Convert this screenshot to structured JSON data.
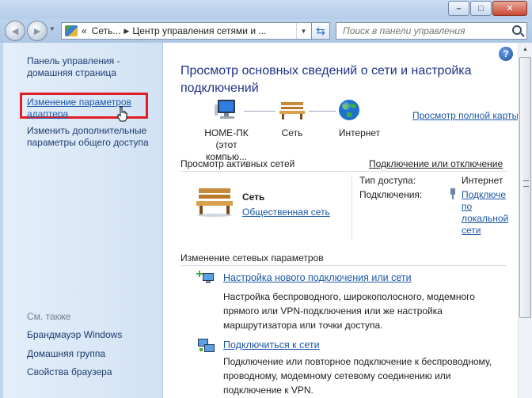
{
  "window": {
    "minimize_glyph": "–",
    "maximize_glyph": "□",
    "close_glyph": "✕"
  },
  "toolbar": {
    "back_glyph": "◄",
    "forward_glyph": "►",
    "address_chevron": "«",
    "breadcrumb_1": "Сеть...",
    "breadcrumb_2": "Центр управления сетями и ...",
    "breadcrumb_sep": "▶",
    "search_placeholder": "Поиск в панели управления"
  },
  "sidebar": {
    "home": "Панель управления - домашняя страница",
    "adapter": "Изменение параметров адаптера",
    "sharing": "Изменить дополнительные параметры общего доступа",
    "see_also": "См. также",
    "links": [
      "Брандмауэр Windows",
      "Домашняя группа",
      "Свойства браузера"
    ]
  },
  "main": {
    "help": "?",
    "title": "Просмотр основных сведений о сети и настройка подключений",
    "full_map": "Просмотр полной карты",
    "map": {
      "computer": "HOME-ПК",
      "computer_sub": "(этот компью...",
      "network": "Сеть",
      "internet": "Интернет"
    },
    "active_networks": "Просмотр активных сетей",
    "connect_disconnect": "Подключение или отключение",
    "network": {
      "name": "Сеть",
      "category": "Общественная сеть",
      "access_type_label": "Тип доступа:",
      "access_type_value": "Интернет",
      "connections_label": "Подключения:",
      "connections_value": [
        "Подключе",
        "по",
        "локальной",
        "сети"
      ]
    },
    "change_settings": "Изменение сетевых параметров",
    "tasks": [
      {
        "title": "Настройка нового подключения или сети",
        "desc": [
          "Настройка беспроводного, широкополосного, модемного",
          "прямого или VPN-подключения или же настройка",
          "маршрутизатора или точки доступа."
        ]
      },
      {
        "title": "Подключиться к сети",
        "desc": [
          "Подключение или повторное подключение к беспроводному,",
          "проводному, модемному сетевому соединению или",
          "подключение к VPN."
        ]
      }
    ]
  }
}
